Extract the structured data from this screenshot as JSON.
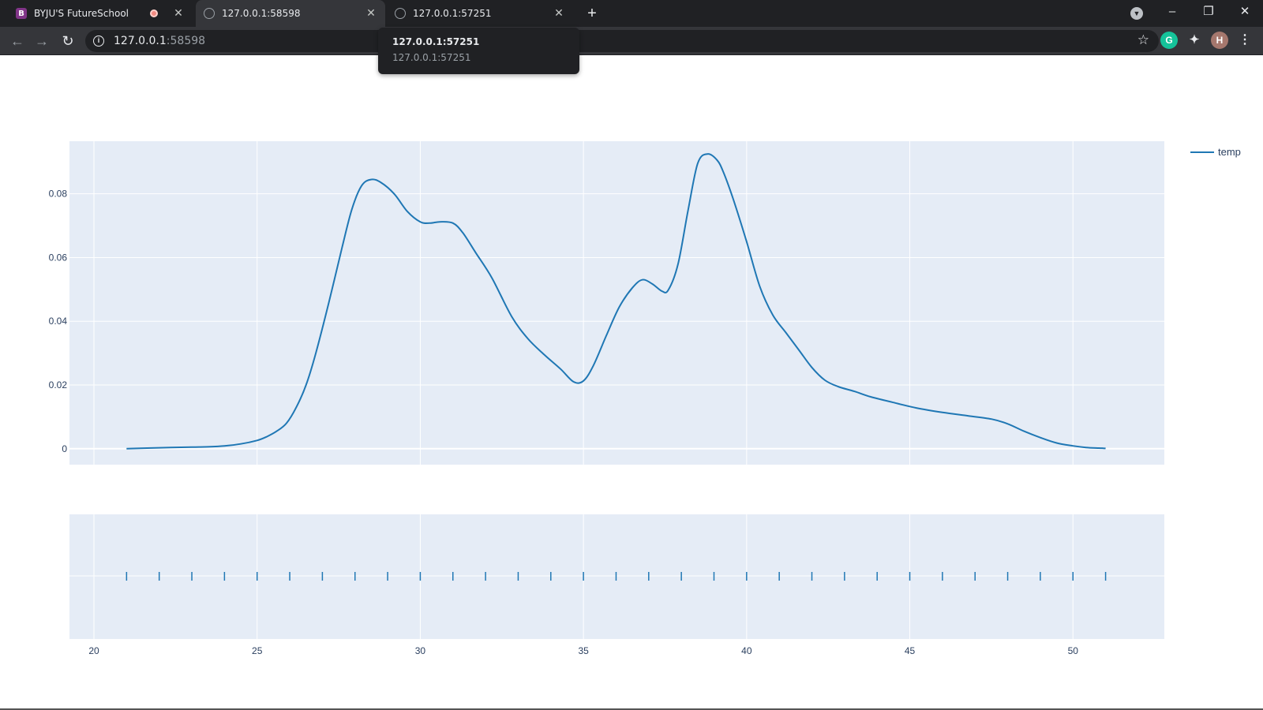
{
  "browser": {
    "tabs": [
      {
        "title": "BYJU'S FutureSchool",
        "favicon": "byjus-logo-icon",
        "recording": true
      },
      {
        "title": "127.0.0.1:58598",
        "favicon": "globe-icon",
        "active": true
      },
      {
        "title": "127.0.0.1:57251",
        "favicon": "globe-icon"
      }
    ],
    "tooltip": {
      "title": "127.0.0.1:57251",
      "subtitle": "127.0.0.1:57251"
    },
    "address": {
      "host": "127.0.0.1",
      "port": ":58598"
    },
    "profile_initial": "H",
    "colors": {
      "chrome_dark": "#202124",
      "chrome_toolbar": "#35363a",
      "grammarly": "#15c39a",
      "profile": "#a5776d",
      "byjus": "#813588"
    }
  },
  "chart_data": {
    "type": "line",
    "plot_bg": "#e5ecf6",
    "line_color": "#1f77b4",
    "grid": true,
    "legend": {
      "entries": [
        "temp"
      ],
      "position": "top-right outside"
    },
    "xlim": [
      19.25,
      52.8
    ],
    "ylim": [
      -0.005,
      0.0965
    ],
    "x_ticks": [
      20,
      25,
      30,
      35,
      40,
      45,
      50
    ],
    "x_tick_labels": [
      "20",
      "25",
      "30",
      "35",
      "40",
      "45",
      "50"
    ],
    "y_ticks": [
      0,
      0.02,
      0.04,
      0.06,
      0.08
    ],
    "y_tick_labels": [
      "0",
      "0.02",
      "0.04",
      "0.06",
      "0.08"
    ],
    "series": [
      {
        "name": "temp",
        "x": [
          21,
          22,
          23,
          23.5,
          24,
          24.5,
          25,
          25.3,
          25.6,
          25.9,
          26.2,
          26.5,
          26.8,
          27.2,
          27.6,
          27.9,
          28.2,
          28.5,
          28.8,
          29.2,
          29.6,
          30,
          30.3,
          30.6,
          31,
          31.3,
          31.7,
          32.2,
          32.8,
          33.3,
          33.8,
          34.3,
          34.7,
          35,
          35.3,
          35.7,
          36.1,
          36.5,
          36.8,
          37.1,
          37.4,
          37.6,
          37.9,
          38.2,
          38.5,
          38.8,
          39.1,
          39.3,
          39.6,
          40,
          40.4,
          40.8,
          41.2,
          41.6,
          42,
          42.4,
          42.8,
          43.3,
          43.8,
          44.5,
          45.2,
          46,
          46.8,
          47.5,
          48,
          48.5,
          49,
          49.5,
          50,
          50.4,
          50.8,
          51
        ],
        "y": [
          0,
          0.0003,
          0.0005,
          0.0006,
          0.0009,
          0.0015,
          0.0026,
          0.0038,
          0.0055,
          0.008,
          0.013,
          0.02,
          0.03,
          0.046,
          0.063,
          0.075,
          0.0825,
          0.0845,
          0.0835,
          0.08,
          0.0745,
          0.0712,
          0.0708,
          0.0712,
          0.0708,
          0.0678,
          0.0615,
          0.0535,
          0.0415,
          0.0345,
          0.0295,
          0.025,
          0.021,
          0.0213,
          0.026,
          0.0355,
          0.0445,
          0.0505,
          0.053,
          0.0518,
          0.0495,
          0.0498,
          0.058,
          0.0745,
          0.0895,
          0.0925,
          0.0905,
          0.0865,
          0.078,
          0.065,
          0.051,
          0.042,
          0.0365,
          0.031,
          0.0255,
          0.0215,
          0.0195,
          0.018,
          0.0163,
          0.0145,
          0.0128,
          0.0114,
          0.0103,
          0.0093,
          0.0078,
          0.0055,
          0.0035,
          0.0018,
          0.0009,
          0.0004,
          0.0002,
          0.0001
        ]
      }
    ],
    "rug": {
      "x": [
        21,
        22,
        23,
        24,
        25,
        26,
        27,
        28,
        29,
        30,
        31,
        32,
        33,
        34,
        35,
        36,
        37,
        38,
        39,
        40,
        41,
        42,
        43,
        44,
        45,
        46,
        47,
        48,
        49,
        50,
        51
      ]
    }
  }
}
